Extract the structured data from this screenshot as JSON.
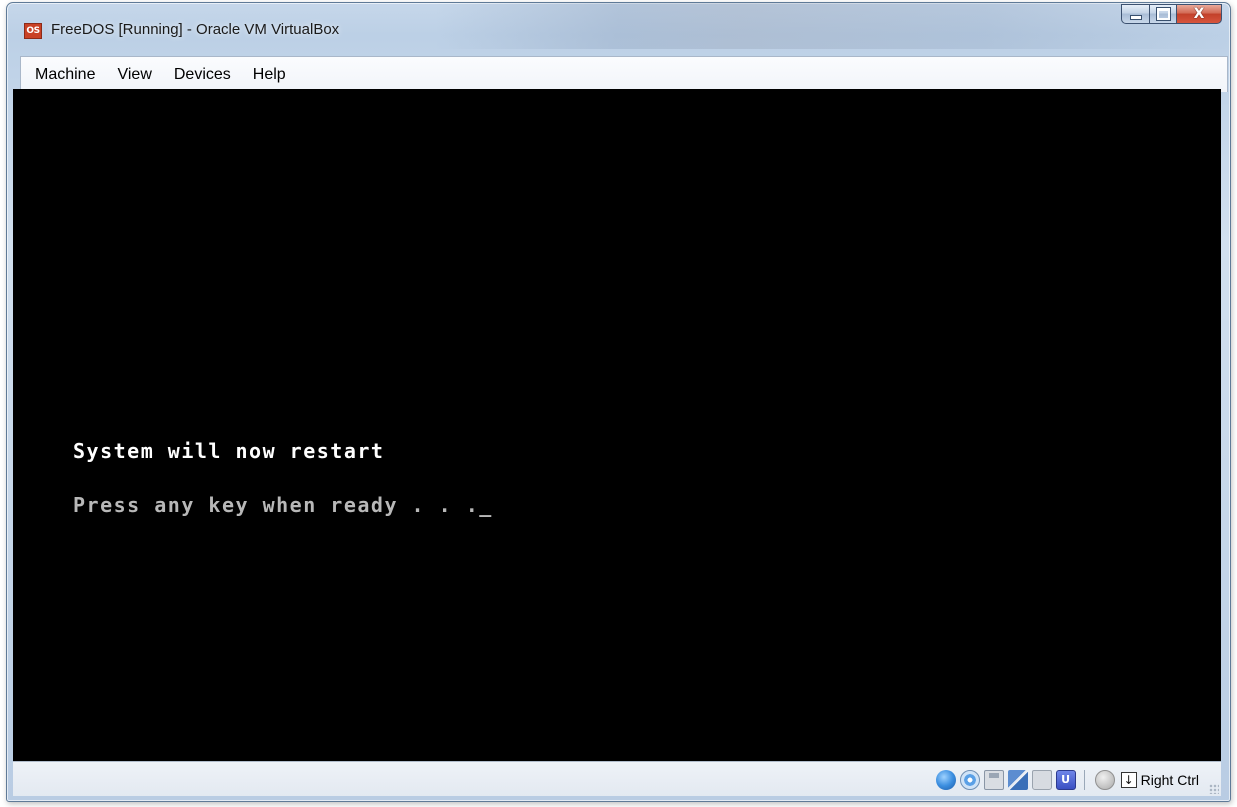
{
  "window": {
    "title": "FreeDOS [Running] - Oracle VM VirtualBox",
    "app_icon_text": "OS",
    "close_glyph": "X"
  },
  "menu": {
    "items": [
      "Machine",
      "View",
      "Devices",
      "Help"
    ]
  },
  "screen": {
    "line1": "System will now restart",
    "line2": "Press any key when ready . . .",
    "cursor": "_"
  },
  "status_bar": {
    "icons": [
      "hard-disk-icon",
      "optical-drive-icon",
      "floppy-icon",
      "network-icon",
      "shared-folders-icon",
      "remote-display-icon",
      "mouse-integration-icon",
      "host-key-icon"
    ],
    "vrdp_text": "U",
    "host_key_arrow": "↓",
    "host_key_label": "Right Ctrl"
  },
  "colors": {
    "screen_background": "#000000",
    "text_bright": "#ffffff",
    "text_dim": "#b8b8b8",
    "close_button": "#c2402a"
  }
}
